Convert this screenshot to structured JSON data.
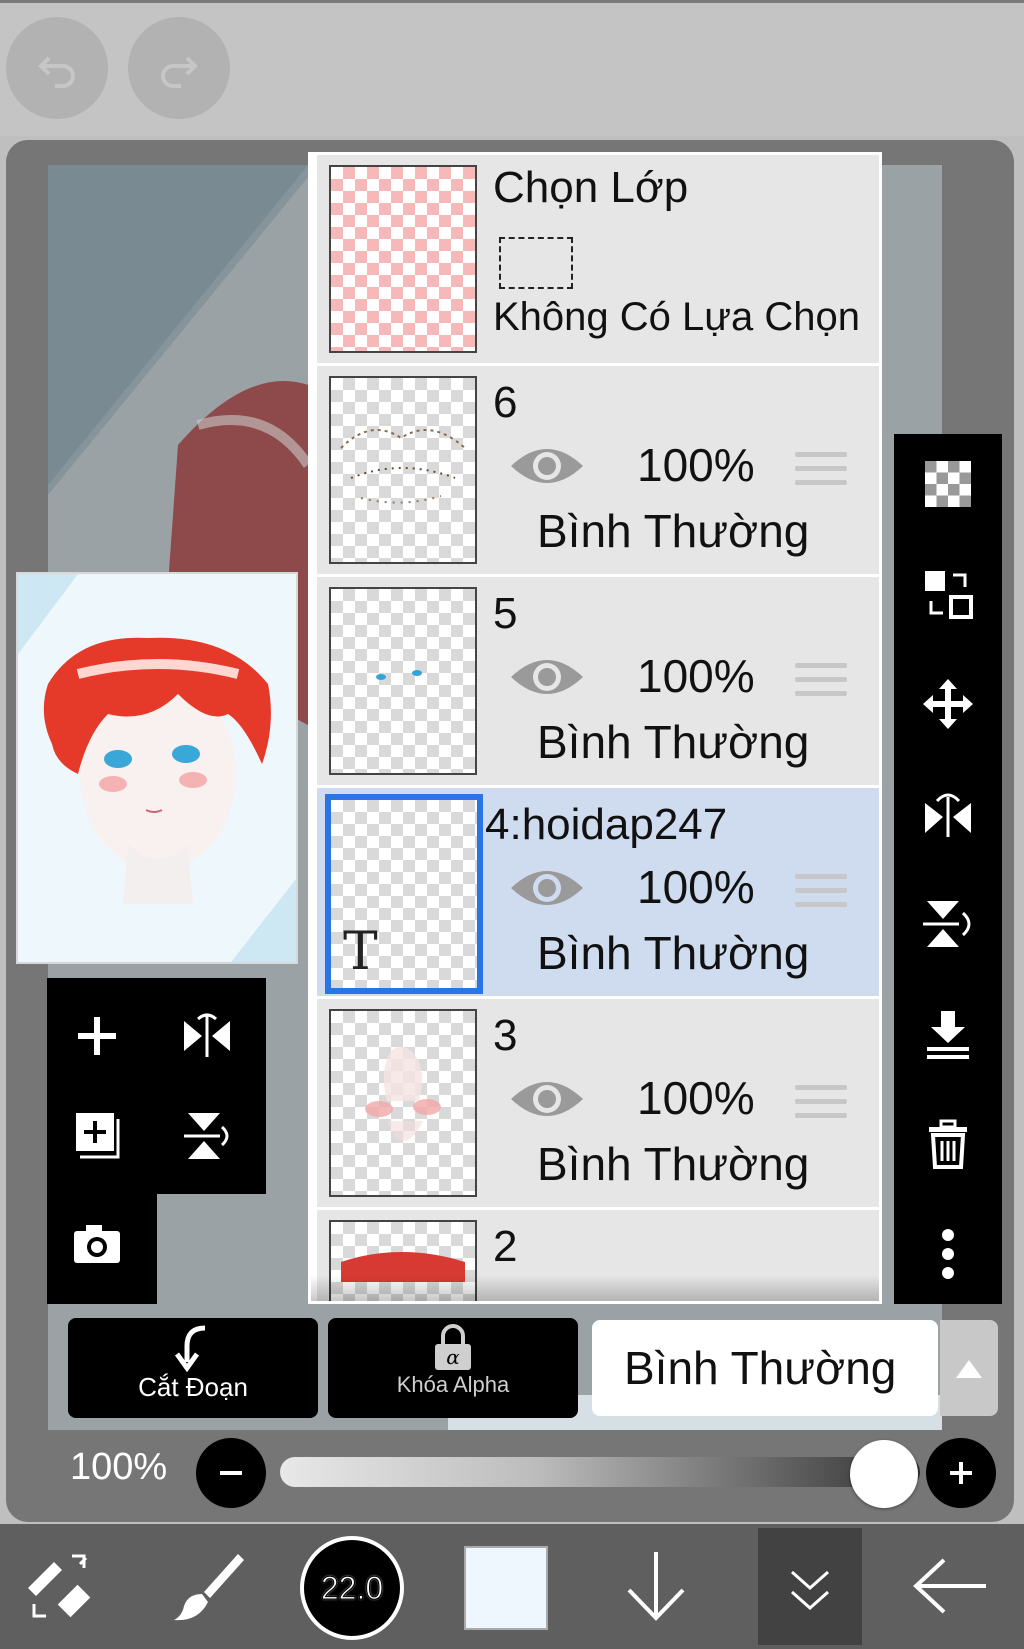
{
  "layer_panel": {
    "selection_layer": {
      "title": "Chọn Lớp",
      "status": "Không Có Lựa Chọn"
    },
    "layers": [
      {
        "name": "6",
        "opacity": "100%",
        "blend": "Bình Thường"
      },
      {
        "name": "5",
        "opacity": "100%",
        "blend": "Bình Thường"
      },
      {
        "name": "4:hoidap247",
        "opacity": "100%",
        "blend": "Bình Thường",
        "text_marker": "T",
        "selected": true
      },
      {
        "name": "3",
        "opacity": "100%",
        "blend": "Bình Thường"
      },
      {
        "name": "2"
      }
    ]
  },
  "actions": {
    "clip_label": "Cắt Đoạn",
    "alpha_lock_label": "Khóa Alpha",
    "blend_mode": "Bình Thường"
  },
  "opacity_slider": {
    "value_label": "100%",
    "level": 1.0
  },
  "bottom_toolbar": {
    "brush_size": "22.0",
    "current_color": "#eef7fd"
  },
  "colors": {
    "selected_border": "#2b74e4",
    "selected_row": "#cfdcef"
  }
}
